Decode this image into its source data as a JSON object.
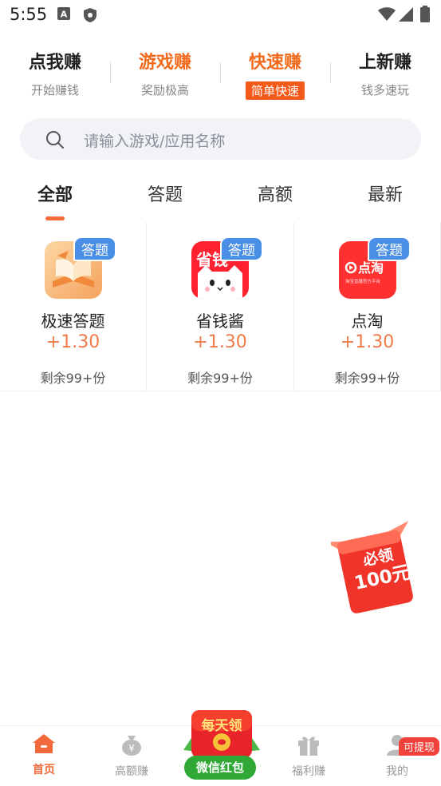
{
  "status_bar": {
    "time": "5:55",
    "icons": [
      "a-icon",
      "shield-icon",
      "wifi-icon",
      "signal-icon",
      "battery-icon"
    ]
  },
  "top_nav": [
    {
      "title": "点我赚",
      "subtitle": "开始赚钱",
      "title_color": "#222222"
    },
    {
      "title": "游戏赚",
      "subtitle": "奖励极高",
      "title_color": "#f26b1d"
    },
    {
      "title": "快速赚",
      "subtitle": "简单快速",
      "title_color": "#f26b1d",
      "badge": true
    },
    {
      "title": "上新赚",
      "subtitle": "钱多速玩",
      "title_color": "#222222"
    }
  ],
  "search": {
    "placeholder": "请输入游戏/应用名称"
  },
  "tabs": [
    "全部",
    "答题",
    "高额",
    "最新"
  ],
  "active_tab": "全部",
  "apps": [
    {
      "name": "极速答题",
      "tag": "答题",
      "reward": "+1.30",
      "remaining": "剩余99+份",
      "icon": "book-icon"
    },
    {
      "name": "省钱酱",
      "tag": "答题",
      "reward": "+1.30",
      "remaining": "剩余99+份",
      "icon": "cat-icon",
      "icon_text": "省钱"
    },
    {
      "name": "点淘",
      "tag": "答题",
      "reward": "+1.30",
      "remaining": "剩余99+份",
      "icon": "diantao-icon",
      "icon_text": "点淘",
      "icon_subtext": "淘宝直播官方平台"
    }
  ],
  "promo": {
    "line1": "必领",
    "line2": "100元"
  },
  "bottom_nav": [
    {
      "label": "首页",
      "icon": "home-icon",
      "active": true
    },
    {
      "label": "高额赚",
      "icon": "money-bag-icon"
    },
    {
      "label": "福利赚",
      "icon": "gift-icon"
    },
    {
      "label": "我的",
      "icon": "user-icon"
    }
  ],
  "center_badge": {
    "top_text": "每天领",
    "label": "微信红包"
  },
  "redeem_tag": "可提现",
  "colors": {
    "accent": "#f26b1d",
    "tag_blue": "#4a8fe6",
    "wechat_green": "#2fa836"
  }
}
